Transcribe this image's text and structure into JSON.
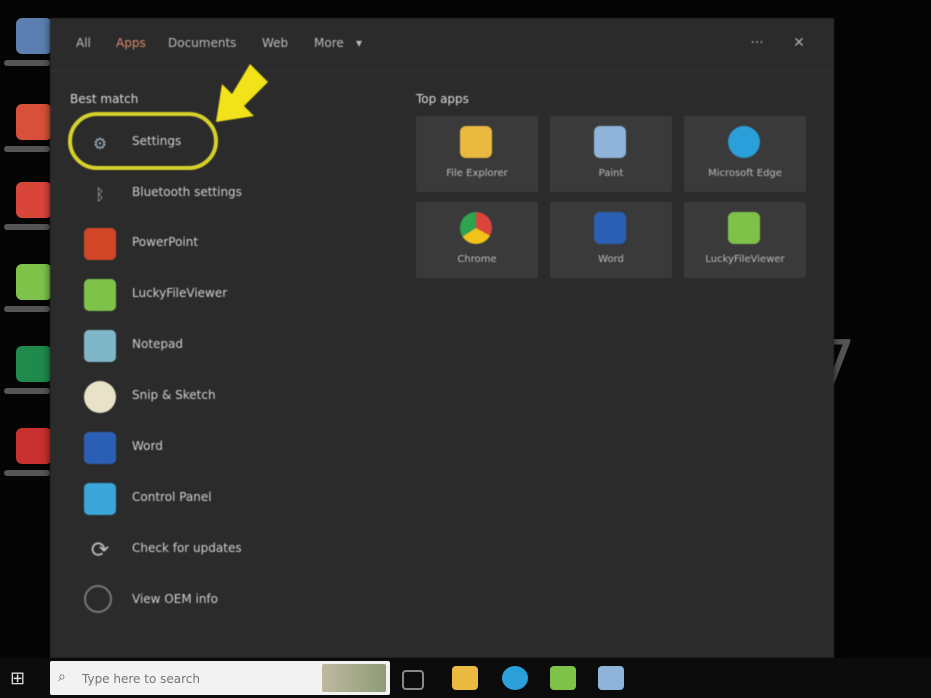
{
  "menu": {
    "tabs": [
      "All",
      "Apps",
      "Documents",
      "Web",
      "More"
    ],
    "active_tab": "Apps",
    "more_symbol": "▾",
    "options_symbol": "···",
    "close_symbol": "✕"
  },
  "best_match": {
    "title": "Best match",
    "items": [
      {
        "label": "Settings",
        "icon": "gear-icon"
      },
      {
        "label": "Bluetooth settings",
        "icon": "bluetooth-icon"
      },
      {
        "label": "PowerPoint",
        "icon": "powerpoint-icon"
      },
      {
        "label": "LuckyFileViewer",
        "icon": "file-viewer-icon"
      },
      {
        "label": "Notepad",
        "icon": "notepad-icon"
      },
      {
        "label": "Snip & Sketch",
        "icon": "snip-icon"
      },
      {
        "label": "Word",
        "icon": "word-icon"
      },
      {
        "label": "Control Panel",
        "icon": "control-panel-icon"
      },
      {
        "label": "Check for updates",
        "icon": "update-icon"
      },
      {
        "label": "View OEM info",
        "icon": "info-icon"
      }
    ]
  },
  "top_apps": {
    "title": "Top apps",
    "tiles": [
      {
        "label": "File Explorer",
        "icon": "folder-icon",
        "color": "#e9b940"
      },
      {
        "label": "Paint",
        "icon": "paint-icon",
        "color": "#8fb4d9"
      },
      {
        "label": "Microsoft Edge",
        "icon": "edge-icon",
        "color": "#2b9fd9"
      },
      {
        "label": "Chrome",
        "icon": "chrome-icon",
        "color": "#d9453b"
      },
      {
        "label": "Word",
        "icon": "word-icon",
        "color": "#2b5fb4"
      },
      {
        "label": "LuckyFileViewer",
        "icon": "file-viewer-icon",
        "color": "#7ec24a"
      }
    ]
  },
  "taskbar": {
    "search_placeholder": "Type here to search"
  },
  "background_digit": "7",
  "colors": {
    "highlight": "#d6d12b",
    "menu_bg": "#2b2b2b",
    "tile_bg": "#3a3a3a"
  }
}
